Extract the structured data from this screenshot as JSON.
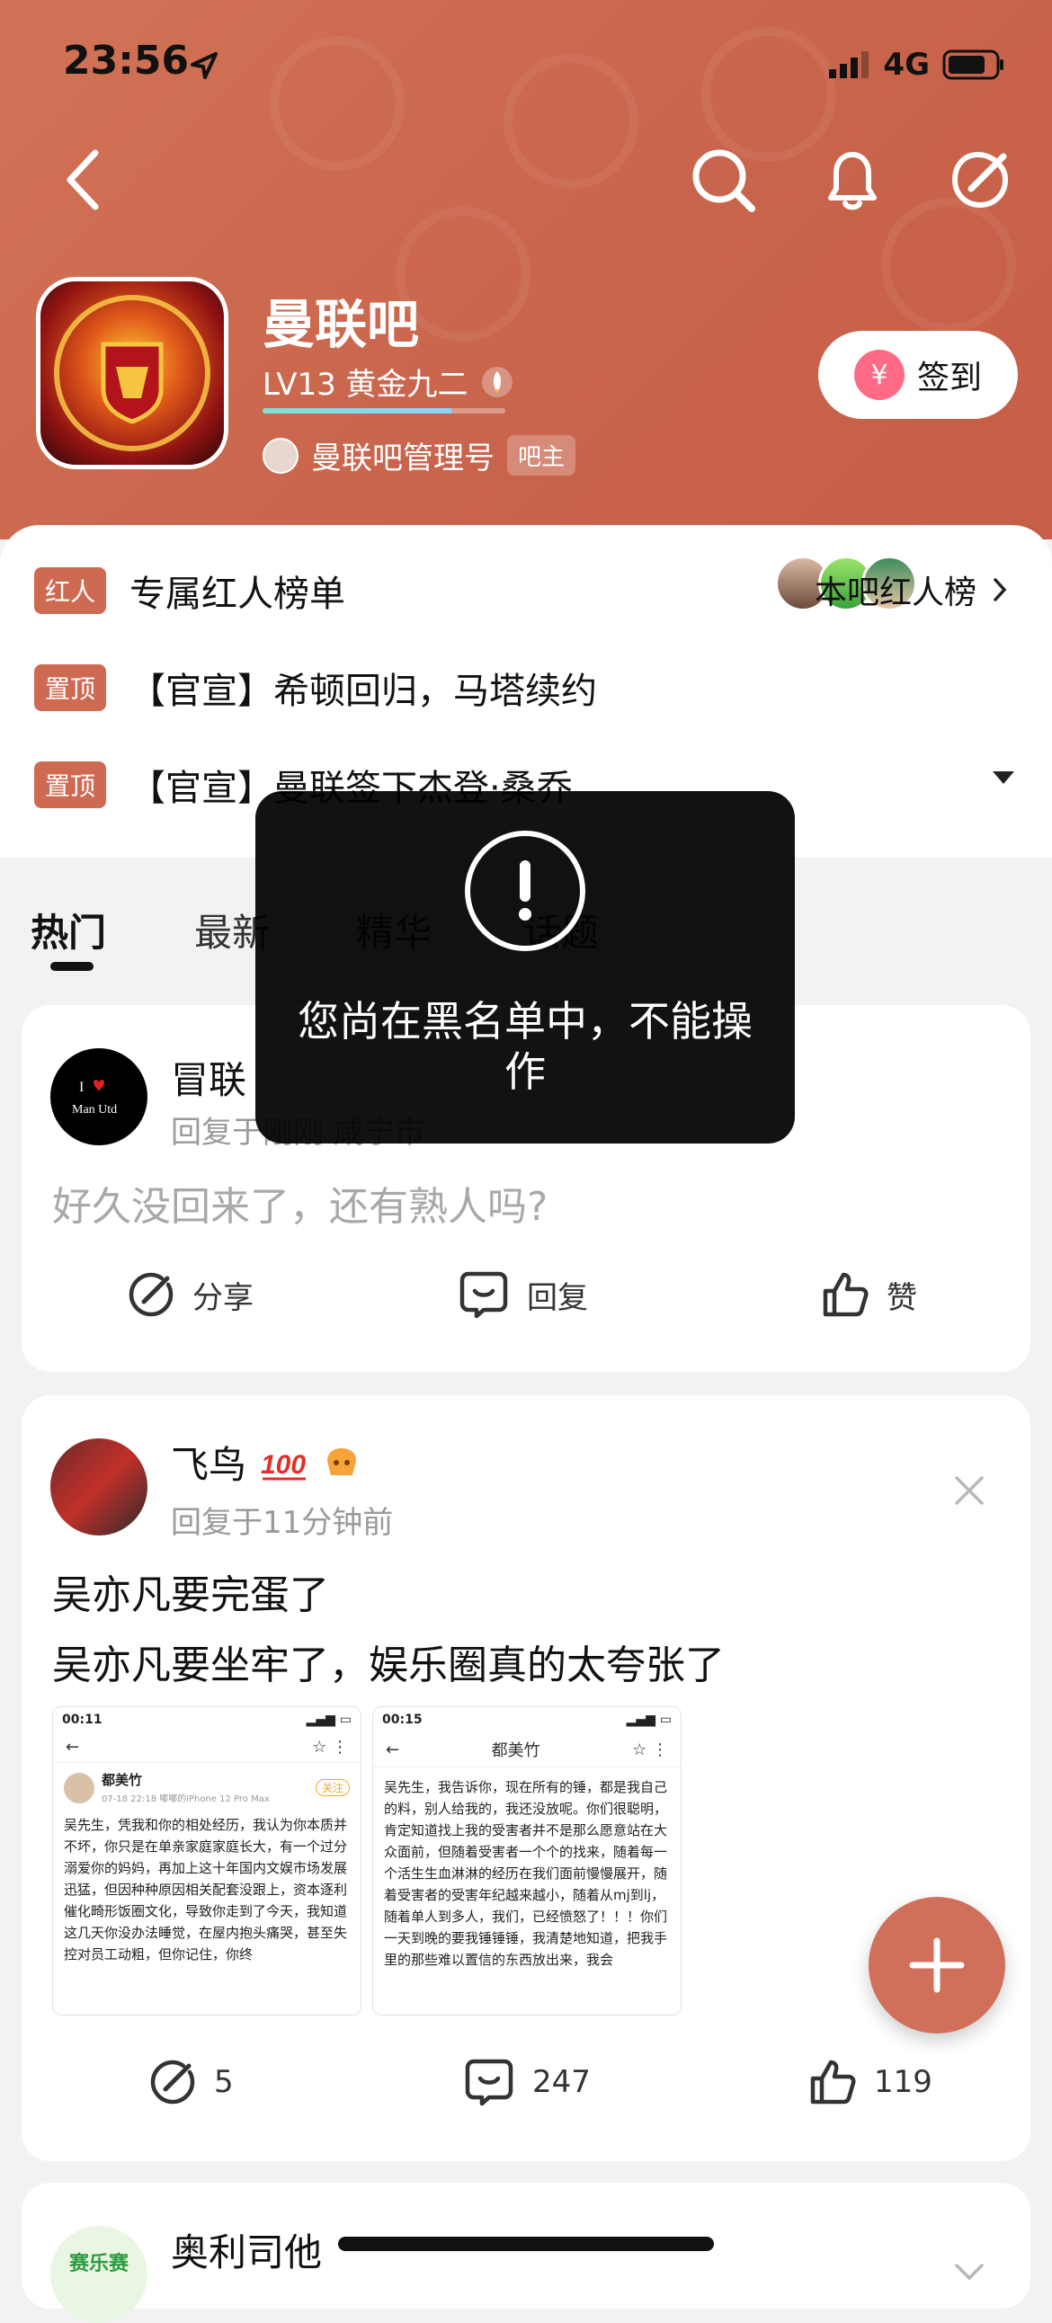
{
  "status_bar": {
    "time": "23:56",
    "network": "4G"
  },
  "forum": {
    "name": "曼联吧",
    "level": "LV13 黄金九二",
    "level_progress": 0.78,
    "admin_name": "曼联吧管理号",
    "admin_badge": "吧主",
    "signin_label": "签到"
  },
  "info": {
    "red_tag": "红人",
    "red_title": "专属红人榜单",
    "red_link": "本吧红人榜",
    "pinned": [
      {
        "tag": "置顶",
        "text": "【官宣】希顿回归，马塔续约"
      },
      {
        "tag": "置顶",
        "text": "【官宣】曼联签下杰登·桑乔"
      }
    ]
  },
  "tabs": [
    "热门",
    "最新",
    "精华",
    "话题"
  ],
  "posts": [
    {
      "user": "冒联",
      "meta": "回复于刚刚  咸宁市",
      "text": "好久没回来了，还有熟人吗?",
      "actions": {
        "share": "分享",
        "reply": "回复",
        "like": "赞"
      }
    },
    {
      "user": "飞鸟",
      "meta": "回复于11分钟前",
      "lines": [
        "吴亦凡要完蛋了",
        "吴亦凡要坐牢了，娱乐圈真的太夸张了"
      ],
      "counts": {
        "share": "5",
        "reply": "247",
        "like": "119"
      },
      "images": [
        {
          "time": "00:11",
          "name": "都美竹",
          "follow": "关注",
          "sub": "07-18 22:18  嘟嘟的iPhone 12 Pro Max",
          "body": "吴先生，凭我和你的相处经历，我认为你本质并不坏，你只是在单亲家庭家庭长大，有一个过分溺爱你的妈妈，再加上这十年国内文娱市场发展迅猛，但因种种原因相关配套没跟上，资本逐利催化畸形饭圈文化，导致你走到了今天，我知道这几天你没办法睡觉，在屋内抱头痛哭，甚至失控对员工动粗，但你记住，你终"
        },
        {
          "time": "00:15",
          "name": "都美竹",
          "body": "吴先生，我告诉你，现在所有的锤，都是我自己的料，别人给我的，我还没放呢。你们很聪明，肯定知道找上我的受害者并不是那么愿意站在大众面前，但随着受害者一个个的找来，随着每一个活生生血淋淋的经历在我们面前慢慢展开，随着受害者的受害年纪越来越小，随着从mj到lj，随着单人到多人，我们，已经愤怒了！！！你们一天到晚的要我锤锤锤，我清楚地知道，把我手里的那些难以置信的东西放出来，我会"
        }
      ]
    },
    {
      "user": "奥利司他",
      "avatar_text": "赛乐赛"
    }
  ],
  "toast": {
    "message": "您尚在黑名单中，不能操作"
  }
}
